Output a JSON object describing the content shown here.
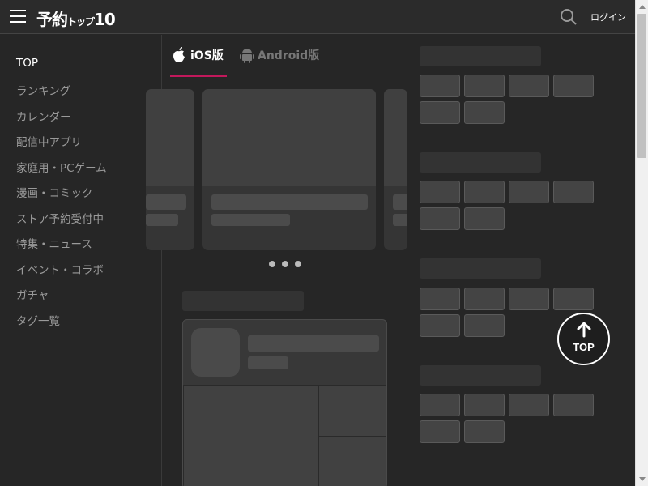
{
  "header": {
    "logo_main": "予約",
    "logo_small": "トップ",
    "logo_num": "10",
    "login_label": "ログイン"
  },
  "sidebar": {
    "items": [
      {
        "label": "TOP",
        "active": true
      },
      {
        "label": "ランキング"
      },
      {
        "label": "カレンダー"
      },
      {
        "label": "配信中アプリ"
      },
      {
        "label": "家庭用・PCゲーム"
      },
      {
        "label": "漫画・コミック"
      },
      {
        "label": "ストア予約受付中"
      },
      {
        "label": "特集・ニュース"
      },
      {
        "label": "イベント・コラボ"
      },
      {
        "label": "ガチャ"
      },
      {
        "label": "タグ一覧"
      }
    ]
  },
  "tabs": [
    {
      "label": "iOS版",
      "icon": "apple-icon",
      "selected": true
    },
    {
      "label": "Android版",
      "icon": "android-icon",
      "selected": false
    }
  ],
  "carousel": {
    "pages": 3
  },
  "top_button": {
    "label": "TOP"
  },
  "colors": {
    "accent": "#c2185b",
    "background": "#262626",
    "placeholder": "#404040"
  }
}
